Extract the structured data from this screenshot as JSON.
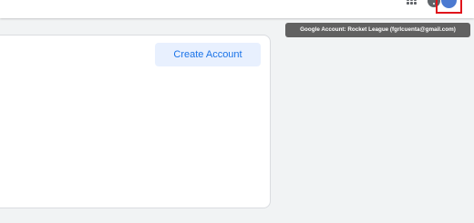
{
  "header": {
    "icons": [
      "apps-grid-icon",
      "help-icon",
      "more-vert-icon",
      "account-avatar-icon"
    ],
    "avatar_highlight_color": "#e0141b"
  },
  "tooltip": {
    "text": "Google Account: Rocket League (fgrlcuenta@gmail.com)"
  },
  "main": {
    "create_account_label": "Create Account",
    "accent_color": "#1a73e8"
  }
}
